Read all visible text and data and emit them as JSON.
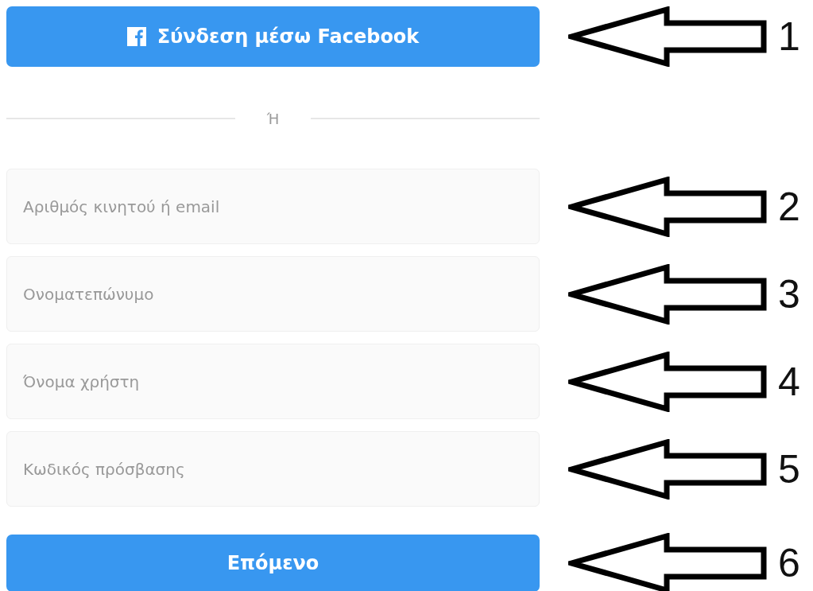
{
  "facebook_button": {
    "label": "Σύνδεση μέσω Facebook"
  },
  "divider": {
    "text": "Ή"
  },
  "fields": [
    {
      "placeholder": "Αριθμός κινητού ή email"
    },
    {
      "placeholder": "Ονοματεπώνυμο"
    },
    {
      "placeholder": "Όνομα χρήστη"
    },
    {
      "placeholder": "Κωδικός πρόσβασης"
    }
  ],
  "next_button": {
    "label": "Επόμενο"
  },
  "annotations": [
    {
      "number": "1"
    },
    {
      "number": "2"
    },
    {
      "number": "3"
    },
    {
      "number": "4"
    },
    {
      "number": "5"
    },
    {
      "number": "6"
    }
  ]
}
